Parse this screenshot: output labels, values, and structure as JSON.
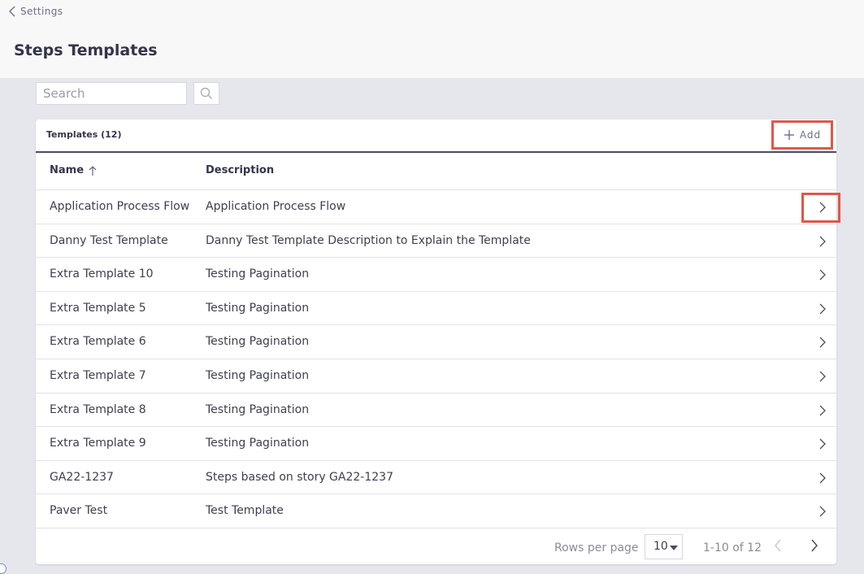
{
  "breadcrumb": {
    "label": "Settings"
  },
  "page": {
    "title": "Steps Templates"
  },
  "search": {
    "placeholder": "Search",
    "value": ""
  },
  "card": {
    "title": "Templates (12)",
    "add_label": "Add"
  },
  "table": {
    "columns": {
      "name": "Name",
      "description": "Description"
    },
    "sort_icon": "arrow-up-icon",
    "rows": [
      {
        "name": "Application Process Flow",
        "description": "Application Process Flow"
      },
      {
        "name": "Danny Test Template",
        "description": "Danny Test Template Description to Explain the Template"
      },
      {
        "name": "Extra Template 10",
        "description": "Testing Pagination"
      },
      {
        "name": "Extra Template 5",
        "description": "Testing Pagination"
      },
      {
        "name": "Extra Template 6",
        "description": "Testing Pagination"
      },
      {
        "name": "Extra Template 7",
        "description": "Testing Pagination"
      },
      {
        "name": "Extra Template 8",
        "description": "Testing Pagination"
      },
      {
        "name": "Extra Template 9",
        "description": "Testing Pagination"
      },
      {
        "name": "GA22-1237",
        "description": "Steps based on story GA22-1237"
      },
      {
        "name": "Paver Test",
        "description": "Test Template"
      }
    ]
  },
  "pagination": {
    "rows_per_page_label": "Rows per page",
    "rows_per_page_value": "10",
    "range_label": "1-10 of 12"
  },
  "colors": {
    "highlight": "#e0574a",
    "header_border": "#4a4d63",
    "background": "#e6e6ed"
  }
}
